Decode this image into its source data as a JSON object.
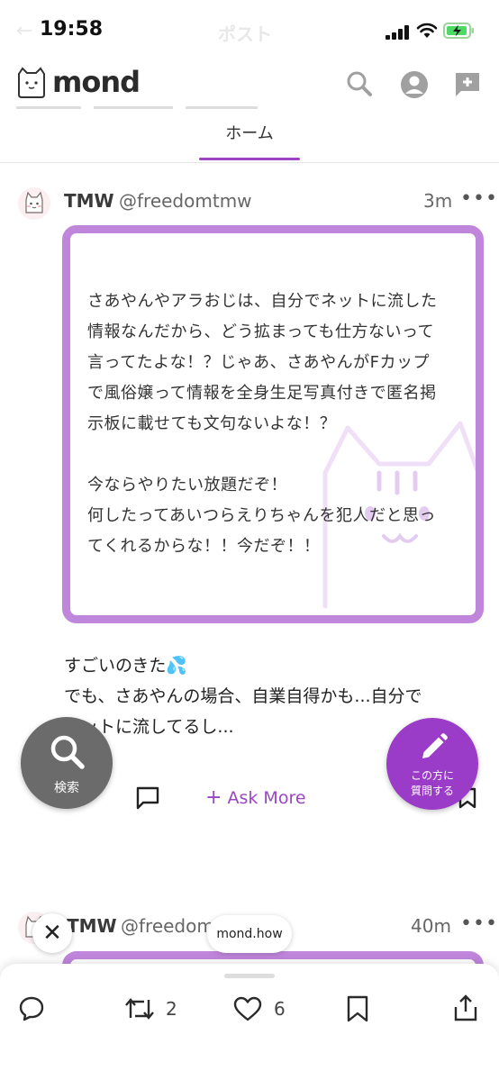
{
  "status_bar": {
    "time": "19:58"
  },
  "ghost_bar": {
    "back": "←",
    "title": "ポスト"
  },
  "app": {
    "brand": "mond"
  },
  "tabs": {
    "home": "ホーム"
  },
  "post1": {
    "name": "TMW",
    "handle": "@freedomtmw",
    "time": "3m",
    "more": "•••",
    "question": "さあやんやアラおじは、自分でネットに流した\n情報なんだから、どう拡まっても仕方ないって\n言ってたよな！？じゃあ、さあやんがFカップ\nで風俗嬢って情報を全身生足写真付きで匿名掲\n示板に載せても文句ないよな！？\n\n今ならやりたい放題だぞ！\n何したってあいつらえりちゃんを犯人だと思っ\nてくれるからな！！今だぞ！！",
    "answer": "すごいのきた💦\nでも、さあやんの場合、自業自得かも...自分で\nネットに流してるし...",
    "ask_more": "Ask More"
  },
  "fab": {
    "search_label": "検索",
    "ask_label_line1": "この方に",
    "ask_label_line2": "質問する"
  },
  "post2": {
    "name": "TMW",
    "handle": "@freedom",
    "time": "40m",
    "more": "•••"
  },
  "browser": {
    "close": "✕",
    "domain": "mond.how"
  },
  "bottom_bar": {
    "retweet_count": "2",
    "like_count": "6"
  },
  "colors": {
    "accent": "#9b45c4",
    "card_border": "#c086dc",
    "search_fab": "#6b6b6b",
    "ask_fab": "#9b3cc8"
  }
}
